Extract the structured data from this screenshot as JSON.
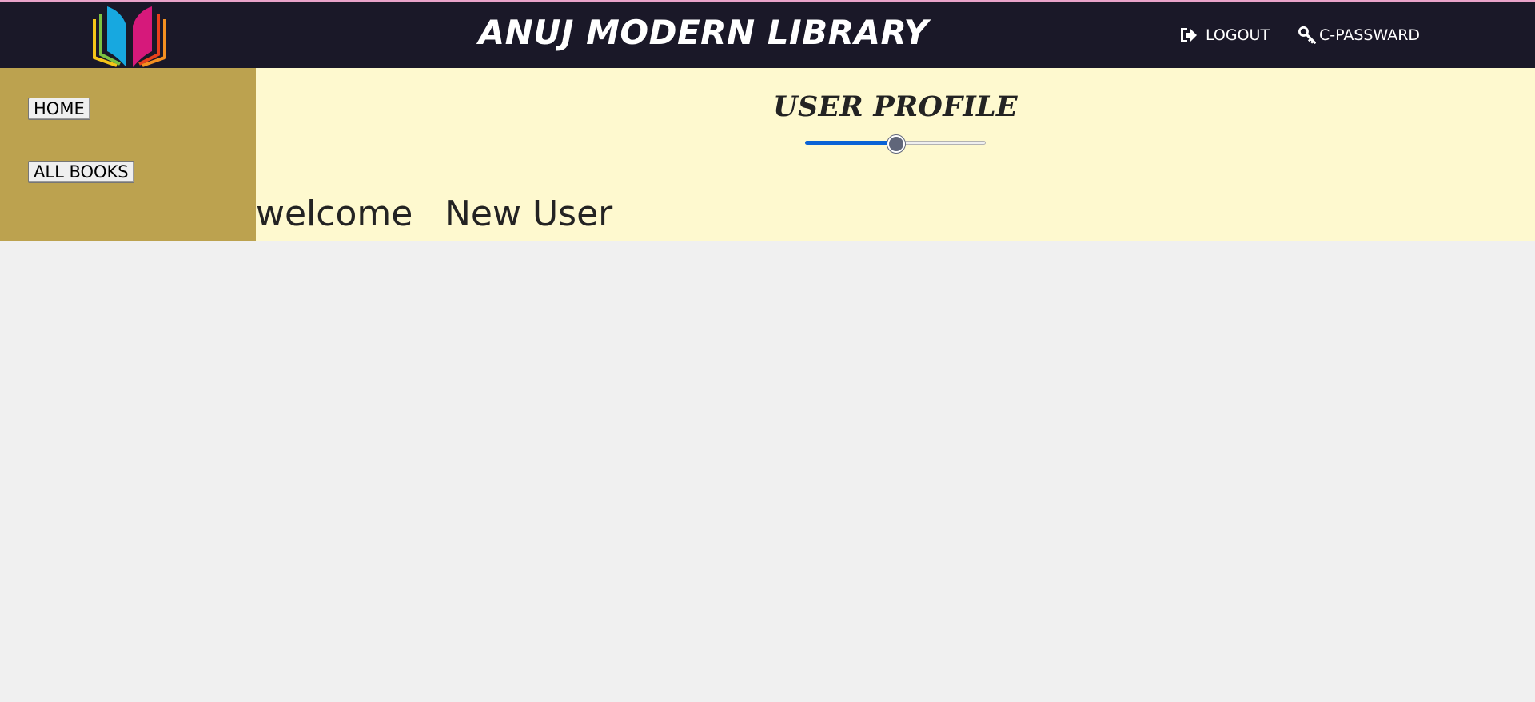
{
  "header": {
    "logo_icon": "open-book-logo",
    "title": "ANUJ MODERN LIBRARY",
    "logout": {
      "label": "LOGOUT",
      "icon": "logout-icon"
    },
    "change_password": {
      "label": "C-PASSWARD",
      "icon": "key-icon"
    }
  },
  "sidebar": {
    "items": [
      {
        "label": "HOME"
      },
      {
        "label": "ALL BOOKS"
      }
    ]
  },
  "main": {
    "title": "USER PROFILE",
    "slider": {
      "value": 0.5,
      "accent": "#0a63d6"
    },
    "welcome": "welcome",
    "user_name": "New User"
  },
  "colors": {
    "header_bg": "#1a1828",
    "sidebar_bg": "#bca24f",
    "main_bg": "#fef9cf",
    "page_bg": "#f0f0f0"
  }
}
